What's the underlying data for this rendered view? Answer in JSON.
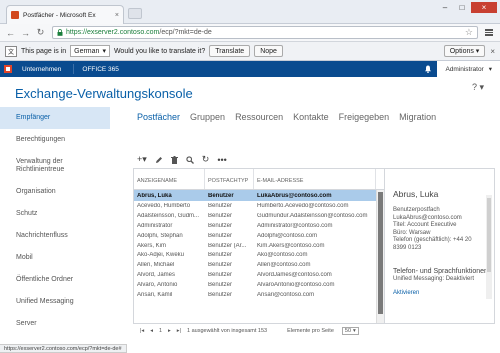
{
  "browser": {
    "tab_title": "Postfächer - Microsoft Ex",
    "url_host": "https://exserver2.contoso.com",
    "url_path": "/ecp/?mkt=de-de",
    "status_url": "https://exserver2.contoso.com/ecp/?mkt=de-de#"
  },
  "translate": {
    "prefix": "This page is in",
    "language": "German",
    "question": "Would you like to translate it?",
    "translate_label": "Translate",
    "nope_label": "Nope",
    "options_label": "Options"
  },
  "o365": {
    "nav_unternehmen": "Unternehmen",
    "nav_office": "OFFICE 365",
    "user": "Administrator",
    "help": "?"
  },
  "header": {
    "title": "Exchange-Verwaltungskonsole"
  },
  "sidebar": {
    "items": [
      "Empfänger",
      "Berechtigungen",
      "Verwaltung der Richtlinientreue",
      "Organisation",
      "Schutz",
      "Nachrichtenfluss",
      "Mobil",
      "Öffentliche Ordner",
      "Unified Messaging",
      "Server"
    ]
  },
  "tabs": [
    "Postfächer",
    "Gruppen",
    "Ressourcen",
    "Kontakte",
    "Freigegeben",
    "Migration"
  ],
  "table": {
    "headers": [
      "ANZEIGENAME",
      "POSTFACHTYP",
      "E-MAIL-ADRESSE"
    ],
    "rows": [
      [
        "Abrus, Luka",
        "Benutzer",
        "LukaAbrus@contoso.com"
      ],
      [
        "Acevedo, Humberto",
        "Benutzer",
        "Humberto.Acevedo@contoso.com"
      ],
      [
        "Adalsteinsson, Gudm...",
        "Benutzer",
        "Gudmundur.Adalsteinsson@contoso.com"
      ],
      [
        "Administrator",
        "Benutzer",
        "Administrator@contoso.com"
      ],
      [
        "Adolphi, Stephan",
        "Benutzer",
        "Adolphi@contoso.com"
      ],
      [
        "Akers, Kim",
        "Benutzer (Ar...",
        "Kim.Akers@contoso.com"
      ],
      [
        "Ako-Adjei, Kweku",
        "Benutzer",
        "Ako@contoso.com"
      ],
      [
        "Allen, Michael",
        "Benutzer",
        "Allen@contoso.com"
      ],
      [
        "Alvord, James",
        "Benutzer",
        "AlvordJames@contoso.com"
      ],
      [
        "Alvaro, Antonio",
        "Benutzer",
        "AlvaroAntonio@contoso.com"
      ],
      [
        "Ansari, Kamil",
        "Benutzer",
        "Ansari@contoso.com"
      ]
    ]
  },
  "details": {
    "name": "Abrus, Luka",
    "lines": [
      "Benutzerpostfach",
      "LukaAbrus@contoso.com",
      "Titel: Account Executive",
      "Büro: Warsaw",
      "Telefon (geschäftlich): +44 20",
      "8399 0123"
    ],
    "section": "Telefon- und Sprachfunktionen",
    "um_status": "Unified Messaging: Deaktiviert",
    "link": "Aktivieren"
  },
  "pager": {
    "page": "1",
    "status": "1 ausgewählt von insgesamt 153",
    "per_page_label": "Elemente pro Seite",
    "per_page_value": "50"
  },
  "colors": {
    "accent": "#0a60a8",
    "o365_bar": "#0a4b8f",
    "selected_row": "#aacbea",
    "sidebar_selected": "#d7e6f5"
  }
}
